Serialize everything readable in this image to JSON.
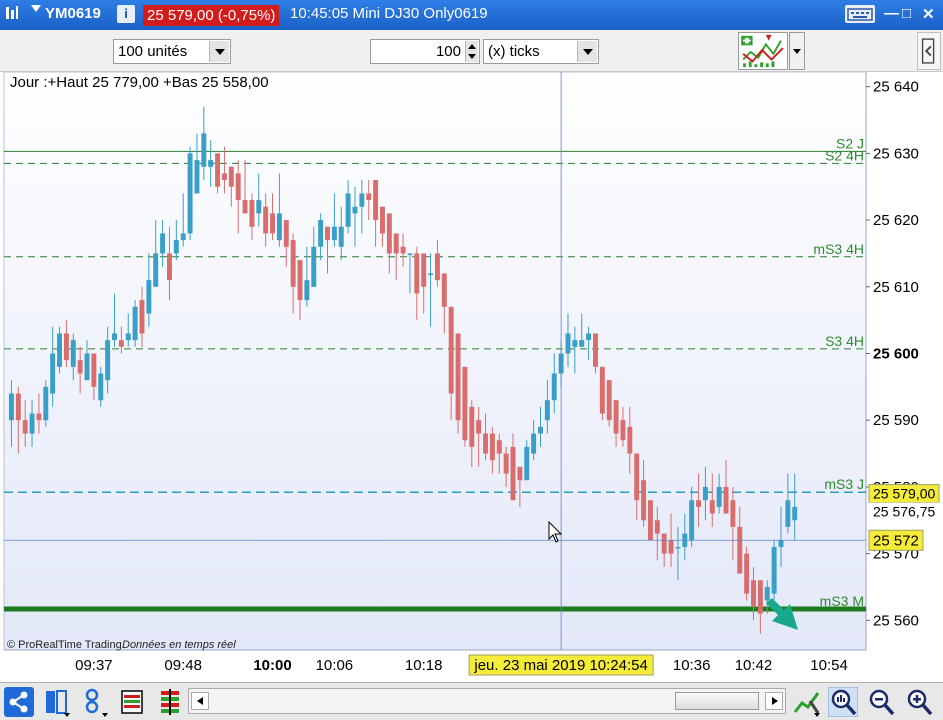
{
  "titlebar": {
    "symbol": "YM0619",
    "info_icon_label": "i",
    "price": "25 579,00 (-0,75%)",
    "description": "10:45:05 Mini DJ30 Only0619",
    "minimize": "—",
    "maximize": "□",
    "close": "✕"
  },
  "toolbar": {
    "units_value": "100 unités",
    "quantity_value": "100",
    "ticks_value": "(x) ticks"
  },
  "chart_header": "Jour :+Haut 25 779,00 +Bas 25 558,00",
  "footer": {
    "copyright": "© ProRealTime Trading",
    "realtime": "Données en temps réel"
  },
  "colors": {
    "titlebar": "#1f6ad6",
    "bullish": "#3a9fc6",
    "bearish": "#d96d6d",
    "level_line": "#2e7d32",
    "support_thick": "#1f7a1f",
    "price_label_bg": "#f5ec3a",
    "cursor_label_bg": "#f5ec3a",
    "arrow": "#1aa88c"
  },
  "icons": {
    "share": "share-icon",
    "template": "template-icon",
    "indicator": "indicator-icon",
    "table": "table-icon",
    "bars": "bars-icon",
    "tools": "tools-icon",
    "zoom_fit": "zoom-fit-icon",
    "zoom_out": "zoom-out-icon",
    "zoom_in": "zoom-in-icon"
  },
  "chart_data": {
    "type": "candlestick",
    "ylim": [
      25556,
      25641
    ],
    "y_ticks": [
      {
        "value": 25640,
        "label": "25 640",
        "bold": false
      },
      {
        "value": 25630,
        "label": "25 630",
        "bold": false
      },
      {
        "value": 25620,
        "label": "25 620",
        "bold": false
      },
      {
        "value": 25610,
        "label": "25 610",
        "bold": false
      },
      {
        "value": 25600,
        "label": "25 600",
        "bold": true
      },
      {
        "value": 25590,
        "label": "25 590",
        "bold": false
      },
      {
        "value": 25580,
        "label": "25 580",
        "bold": false
      },
      {
        "value": 25570,
        "label": "25 570",
        "bold": false
      },
      {
        "value": 25560,
        "label": "25 560",
        "bold": false
      }
    ],
    "x_labels": [
      {
        "label": "09:37",
        "index": 12,
        "bold": false
      },
      {
        "label": "09:48",
        "index": 25,
        "bold": false
      },
      {
        "label": "10:00",
        "index": 38,
        "bold": true
      },
      {
        "label": "10:06",
        "index": 47,
        "bold": false
      },
      {
        "label": "10:18",
        "index": 60,
        "bold": false
      },
      {
        "label": "10:36",
        "index": 99,
        "bold": false
      },
      {
        "label": "10:42",
        "index": 108,
        "bold": false
      },
      {
        "label": "10:54",
        "index": 119,
        "bold": false
      }
    ],
    "x_count": 124,
    "levels": [
      {
        "name": "S2 J",
        "value": 25630.3,
        "style": "solid"
      },
      {
        "name": "S2 4H",
        "value": 25628.5,
        "style": "dashed"
      },
      {
        "name": "mS3 4H",
        "value": 25614.5,
        "style": "dashed"
      },
      {
        "name": "S3 4H",
        "value": 25600.7,
        "style": "dashed"
      },
      {
        "name": "mS3 J",
        "value": 25579.2,
        "style": "dashed-teal"
      },
      {
        "name": "mS3 M",
        "value": 25561.7,
        "style": "thick"
      }
    ],
    "current_price": {
      "value": 25579.0,
      "label": "25 579,00"
    },
    "secondary_price": {
      "value": 25576.75,
      "label": "25 576,75"
    },
    "crosshair": {
      "value": 25572.0,
      "label": "25 572",
      "time_label": "jeu. 23 mai 2019 10:24:54",
      "index": 80
    },
    "candles": [
      {
        "o": 25590,
        "h": 25596,
        "l": 25586,
        "c": 25594
      },
      {
        "o": 25594,
        "h": 25595,
        "l": 25585,
        "c": 25590
      },
      {
        "o": 25590,
        "h": 25593,
        "l": 25586,
        "c": 25588
      },
      {
        "o": 25588,
        "h": 25593,
        "l": 25586,
        "c": 25591
      },
      {
        "o": 25591,
        "h": 25594,
        "l": 25588,
        "c": 25590
      },
      {
        "o": 25590,
        "h": 25596,
        "l": 25589,
        "c": 25595
      },
      {
        "o": 25594,
        "h": 25604,
        "l": 25592,
        "c": 25600
      },
      {
        "o": 25598,
        "h": 25604,
        "l": 25597,
        "c": 25603
      },
      {
        "o": 25603,
        "h": 25605,
        "l": 25598,
        "c": 25599
      },
      {
        "o": 25598,
        "h": 25603,
        "l": 25596,
        "c": 25602
      },
      {
        "o": 25599,
        "h": 25601,
        "l": 25594,
        "c": 25597
      },
      {
        "o": 25596,
        "h": 25602,
        "l": 25596,
        "c": 25600
      },
      {
        "o": 25600,
        "h": 25600,
        "l": 25593,
        "c": 25595
      },
      {
        "o": 25593,
        "h": 25598,
        "l": 25592,
        "c": 25597
      },
      {
        "o": 25596,
        "h": 25604,
        "l": 25594,
        "c": 25602
      },
      {
        "o": 25602,
        "h": 25609,
        "l": 25601,
        "c": 25603
      },
      {
        "o": 25602,
        "h": 25604,
        "l": 25600,
        "c": 25601
      },
      {
        "o": 25602,
        "h": 25606,
        "l": 25601,
        "c": 25603
      },
      {
        "o": 25602,
        "h": 25608,
        "l": 25601,
        "c": 25607
      },
      {
        "o": 25608,
        "h": 25610,
        "l": 25601,
        "c": 25603
      },
      {
        "o": 25606,
        "h": 25615,
        "l": 25604,
        "c": 25611
      },
      {
        "o": 25610,
        "h": 25620,
        "l": 25610,
        "c": 25615
      },
      {
        "o": 25615,
        "h": 25620,
        "l": 25613,
        "c": 25618
      },
      {
        "o": 25615,
        "h": 25619,
        "l": 25608,
        "c": 25611
      },
      {
        "o": 25615,
        "h": 25620,
        "l": 25614,
        "c": 25617
      },
      {
        "o": 25617,
        "h": 25624,
        "l": 25616,
        "c": 25618
      },
      {
        "o": 25618,
        "h": 25631,
        "l": 25617,
        "c": 25630
      },
      {
        "o": 25624,
        "h": 25633,
        "l": 25624,
        "c": 25629
      },
      {
        "o": 25628,
        "h": 25637,
        "l": 25626,
        "c": 25633
      },
      {
        "o": 25628,
        "h": 25632,
        "l": 25625,
        "c": 25629
      },
      {
        "o": 25630,
        "h": 25629,
        "l": 25624,
        "c": 25625
      },
      {
        "o": 25627,
        "h": 25631,
        "l": 25624,
        "c": 25626
      },
      {
        "o": 25628,
        "h": 25628,
        "l": 25622,
        "c": 25625
      },
      {
        "o": 25627,
        "h": 25629,
        "l": 25618,
        "c": 25623
      },
      {
        "o": 25623,
        "h": 25629,
        "l": 25621,
        "c": 25621
      },
      {
        "o": 25623,
        "h": 25624,
        "l": 25617,
        "c": 25619
      },
      {
        "o": 25621,
        "h": 25627,
        "l": 25619,
        "c": 25623
      },
      {
        "o": 25622,
        "h": 25624,
        "l": 25616,
        "c": 25618
      },
      {
        "o": 25621,
        "h": 25624,
        "l": 25617,
        "c": 25618
      },
      {
        "o": 25617,
        "h": 25627,
        "l": 25616,
        "c": 25621
      },
      {
        "o": 25620,
        "h": 25620,
        "l": 25613,
        "c": 25616
      },
      {
        "o": 25617,
        "h": 25618,
        "l": 25606,
        "c": 25610
      },
      {
        "o": 25614,
        "h": 25614,
        "l": 25605,
        "c": 25608
      },
      {
        "o": 25608,
        "h": 25616,
        "l": 25607,
        "c": 25611
      },
      {
        "o": 25610,
        "h": 25619,
        "l": 25610,
        "c": 25616
      },
      {
        "o": 25616,
        "h": 25621,
        "l": 25614,
        "c": 25620
      },
      {
        "o": 25619,
        "h": 25617,
        "l": 25612,
        "c": 25617
      },
      {
        "o": 25617,
        "h": 25624,
        "l": 25616,
        "c": 25619
      },
      {
        "o": 25616,
        "h": 25622,
        "l": 25614,
        "c": 25619
      },
      {
        "o": 25619,
        "h": 25626,
        "l": 25618,
        "c": 25624
      },
      {
        "o": 25621,
        "h": 25625,
        "l": 25616,
        "c": 25622
      },
      {
        "o": 25622,
        "h": 25626,
        "l": 25618,
        "c": 25624
      },
      {
        "o": 25624,
        "h": 25626,
        "l": 25620,
        "c": 25623
      },
      {
        "o": 25626,
        "h": 25624,
        "l": 25616,
        "c": 25620
      },
      {
        "o": 25622,
        "h": 25622,
        "l": 25616,
        "c": 25618
      },
      {
        "o": 25621,
        "h": 25620,
        "l": 25612,
        "c": 25615
      },
      {
        "o": 25618,
        "h": 25617,
        "l": 25611,
        "c": 25615
      },
      {
        "o": 25616,
        "h": 25618,
        "l": 25613,
        "c": 25615
      },
      {
        "o": 25615,
        "h": 25614,
        "l": 25609,
        "c": 25615
      },
      {
        "o": 25615,
        "h": 25616,
        "l": 25605,
        "c": 25609
      },
      {
        "o": 25615,
        "h": 25614,
        "l": 25606,
        "c": 25610
      },
      {
        "o": 25612,
        "h": 25615,
        "l": 25604,
        "c": 25612
      },
      {
        "o": 25615,
        "h": 25617,
        "l": 25610,
        "c": 25611
      },
      {
        "o": 25612,
        "h": 25612,
        "l": 25603,
        "c": 25607
      },
      {
        "o": 25607,
        "h": 25603,
        "l": 25590,
        "c": 25594
      },
      {
        "o": 25603,
        "h": 25599,
        "l": 25588,
        "c": 25590
      },
      {
        "o": 25598,
        "h": 25596,
        "l": 25586,
        "c": 25587
      },
      {
        "o": 25592,
        "h": 25593,
        "l": 25583,
        "c": 25586
      },
      {
        "o": 25590,
        "h": 25592,
        "l": 25583,
        "c": 25588
      },
      {
        "o": 25588,
        "h": 25591,
        "l": 25584,
        "c": 25585
      },
      {
        "o": 25588,
        "h": 25589,
        "l": 25582,
        "c": 25584
      },
      {
        "o": 25587,
        "h": 25588,
        "l": 25582,
        "c": 25585
      },
      {
        "o": 25585,
        "h": 25586,
        "l": 25580,
        "c": 25582
      },
      {
        "o": 25586,
        "h": 25588,
        "l": 25578,
        "c": 25578
      },
      {
        "o": 25583,
        "h": 25583,
        "l": 25577,
        "c": 25581
      },
      {
        "o": 25581,
        "h": 25587,
        "l": 25581,
        "c": 25586
      },
      {
        "o": 25585,
        "h": 25590,
        "l": 25584,
        "c": 25588
      },
      {
        "o": 25588,
        "h": 25592,
        "l": 25586,
        "c": 25589
      },
      {
        "o": 25590,
        "h": 25596,
        "l": 25588,
        "c": 25593
      },
      {
        "o": 25593,
        "h": 25600,
        "l": 25591,
        "c": 25597
      },
      {
        "o": 25597,
        "h": 25602,
        "l": 25595,
        "c": 25600
      },
      {
        "o": 25600,
        "h": 25606,
        "l": 25598,
        "c": 25603
      },
      {
        "o": 25601,
        "h": 25604,
        "l": 25597,
        "c": 25602
      },
      {
        "o": 25601,
        "h": 25606,
        "l": 25601,
        "c": 25602
      },
      {
        "o": 25602,
        "h": 25604,
        "l": 25599,
        "c": 25603
      },
      {
        "o": 25603,
        "h": 25602,
        "l": 25597,
        "c": 25598
      },
      {
        "o": 25598,
        "h": 25593,
        "l": 25590,
        "c": 25591
      },
      {
        "o": 25596,
        "h": 25594,
        "l": 25589,
        "c": 25590
      },
      {
        "o": 25593,
        "h": 25593,
        "l": 25586,
        "c": 25588
      },
      {
        "o": 25590,
        "h": 25592,
        "l": 25586,
        "c": 25587
      },
      {
        "o": 25589,
        "h": 25592,
        "l": 25582,
        "c": 25585
      },
      {
        "o": 25585,
        "h": 25585,
        "l": 25575,
        "c": 25578
      },
      {
        "o": 25581,
        "h": 25584,
        "l": 25574,
        "c": 25575
      },
      {
        "o": 25578,
        "h": 25578,
        "l": 25572,
        "c": 25572
      },
      {
        "o": 25575,
        "h": 25577,
        "l": 25569,
        "c": 25573
      },
      {
        "o": 25573,
        "h": 25573,
        "l": 25568,
        "c": 25570
      },
      {
        "o": 25572,
        "h": 25576,
        "l": 25568,
        "c": 25570
      },
      {
        "o": 25571,
        "h": 25574,
        "l": 25566,
        "c": 25571
      },
      {
        "o": 25571,
        "h": 25576,
        "l": 25569,
        "c": 25573
      },
      {
        "o": 25572,
        "h": 25580,
        "l": 25571,
        "c": 25578
      },
      {
        "o": 25578,
        "h": 25582,
        "l": 25574,
        "c": 25577
      },
      {
        "o": 25578,
        "h": 25583,
        "l": 25575,
        "c": 25580
      },
      {
        "o": 25578,
        "h": 25582,
        "l": 25574,
        "c": 25576
      },
      {
        "o": 25577,
        "h": 25582,
        "l": 25576,
        "c": 25580
      },
      {
        "o": 25580,
        "h": 25584,
        "l": 25576,
        "c": 25576
      },
      {
        "o": 25578,
        "h": 25580,
        "l": 25569,
        "c": 25574
      },
      {
        "o": 25574,
        "h": 25577,
        "l": 25568,
        "c": 25567
      },
      {
        "o": 25570,
        "h": 25571,
        "l": 25563,
        "c": 25564
      },
      {
        "o": 25566,
        "h": 25568,
        "l": 25560,
        "c": 25562
      },
      {
        "o": 25566,
        "h": 25566,
        "l": 25558,
        "c": 25561
      },
      {
        "o": 25563,
        "h": 25566,
        "l": 25561,
        "c": 25565
      },
      {
        "o": 25564,
        "h": 25572,
        "l": 25563,
        "c": 25571
      },
      {
        "o": 25571,
        "h": 25577,
        "l": 25568,
        "c": 25572
      },
      {
        "o": 25574,
        "h": 25582,
        "l": 25573,
        "c": 25578
      },
      {
        "o": 25575,
        "h": 25582,
        "l": 25572,
        "c": 25577
      }
    ]
  }
}
